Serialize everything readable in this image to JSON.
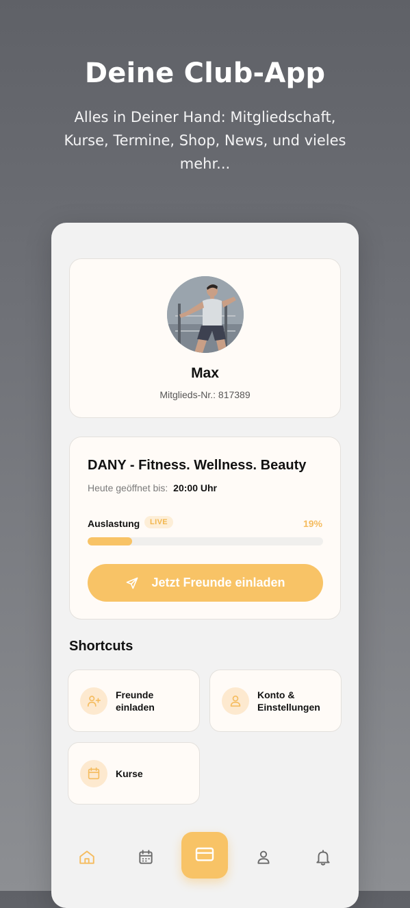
{
  "hero": {
    "title": "Deine Club-App",
    "subtitle": "Alles in Deiner Hand: Mitgliedschaft, Kurse, Termine, Shop, News, und vieles mehr..."
  },
  "profile": {
    "name": "Max",
    "member_label": "Mitglieds-Nr.: 817389"
  },
  "studio": {
    "name": "DANY - Fitness. Wellness. Beauty",
    "open_label": "Heute geöffnet bis:",
    "open_time": "20:00 Uhr",
    "load_label": "Auslastung",
    "live_badge": "LIVE",
    "load_percent": 19,
    "load_percent_text": "19%",
    "invite_button": "Jetzt Freunde einladen"
  },
  "shortcuts": {
    "title": "Shortcuts",
    "items": [
      {
        "label": "Freunde einladen",
        "icon": "user-plus-icon"
      },
      {
        "label": "Konto & Einstellungen",
        "icon": "user-icon"
      },
      {
        "label": "Kurse",
        "icon": "calendar-icon"
      }
    ]
  },
  "bottom_nav": {
    "items": [
      {
        "icon": "home-icon",
        "active": true
      },
      {
        "icon": "calendar-icon",
        "active": false
      },
      {
        "icon": "card-icon",
        "active": false
      },
      {
        "icon": "user-icon",
        "active": false
      },
      {
        "icon": "bell-icon",
        "active": false
      }
    ]
  },
  "colors": {
    "accent": "#f8c366",
    "accent_light": "#fde9cf",
    "card_bg": "#fffbf7",
    "phone_bg": "#f2f2f2"
  }
}
